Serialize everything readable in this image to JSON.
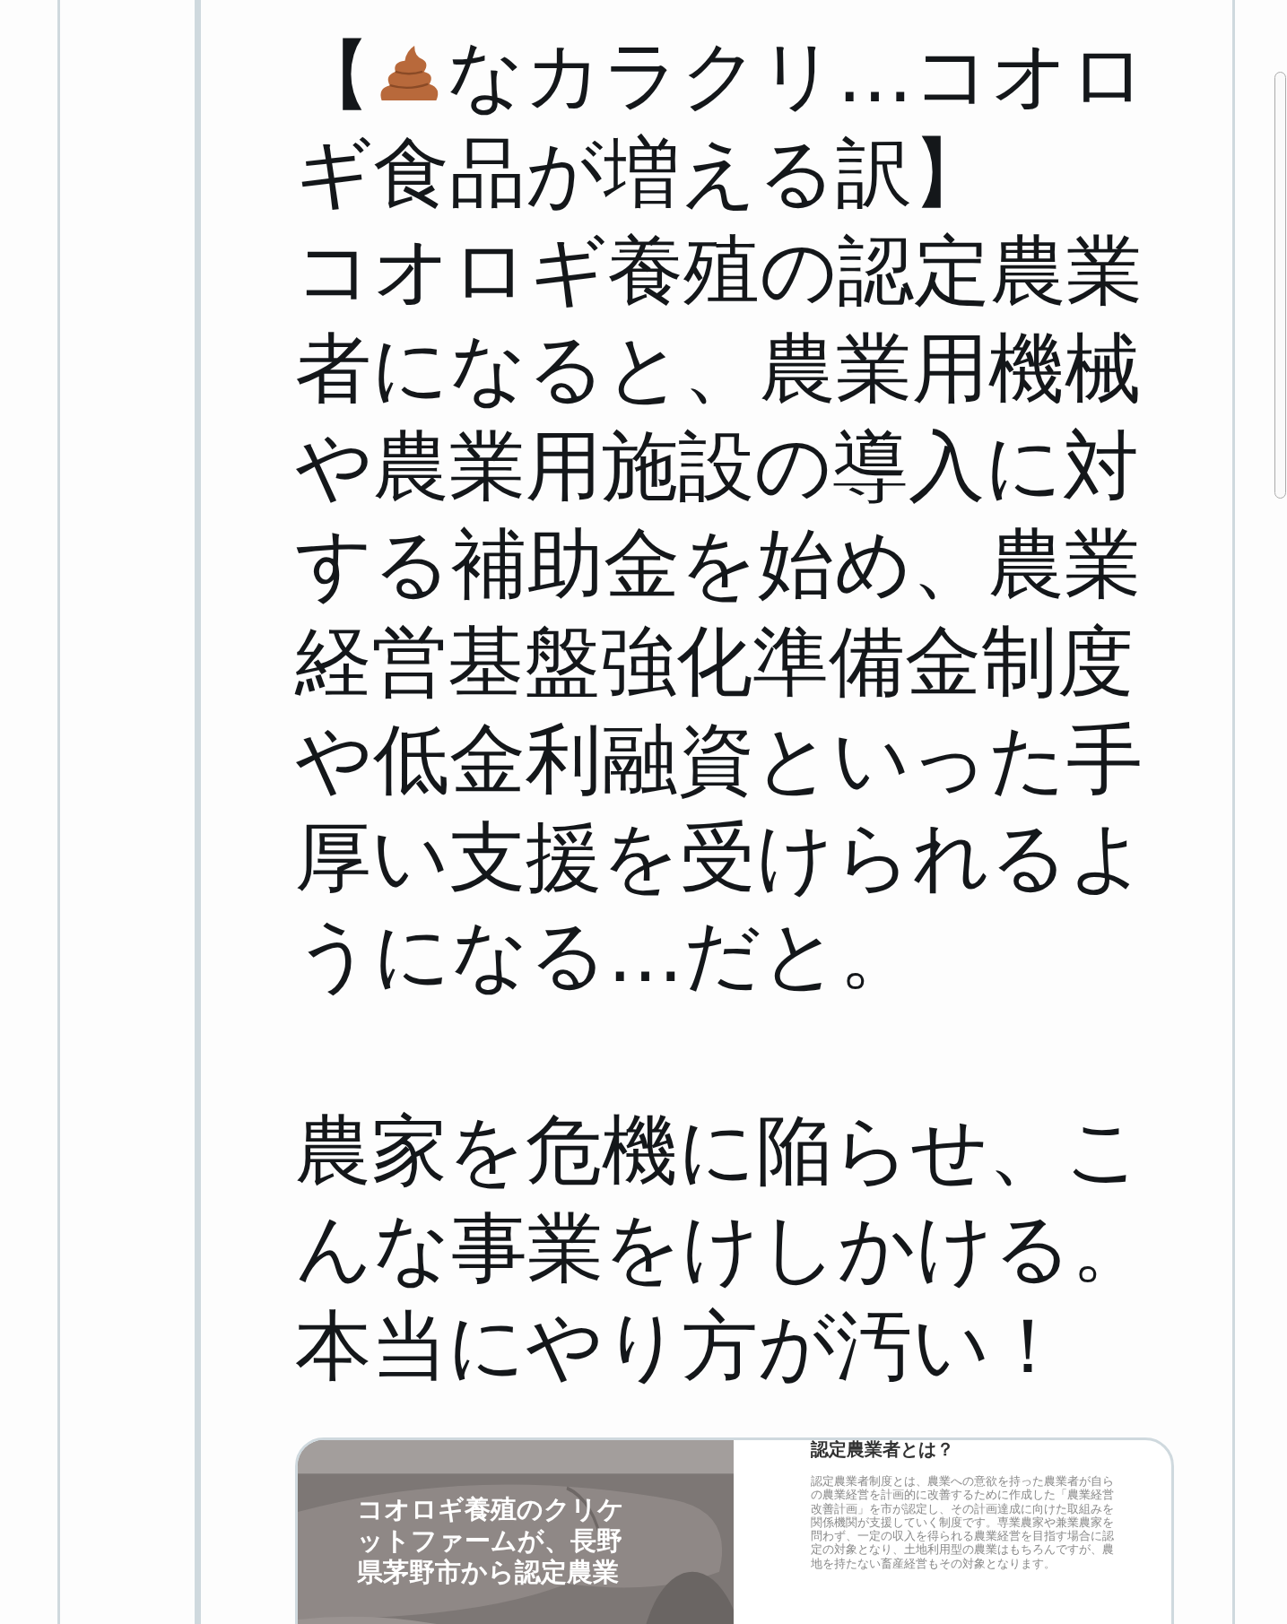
{
  "tweet": {
    "heading": [
      "【",
      "なカラクリ…コオロ",
      "ギ食品が増える訳】"
    ],
    "paragraphs": [
      "コオロギ養殖の認定農業者になると、農業用機械や農業用施設の導入に対する補助金を始め、農業経営基盤強化準備金制度や低金利融資といった手厚い支援を受けられるようになる…だと。",
      "農家を危機に陥らせ、こんな事業をけしかける。",
      "本当にやり方が汚い！"
    ]
  },
  "attachment": {
    "image": {
      "kind": "picture",
      "caption": "コオロギ養殖のクリケットファームが、長野県茅野市から認定農業"
    },
    "document": {
      "title": "認定農業者とは？",
      "text": "認定農業者制度とは、農業への意欲を持った農業者が自らの農業経営を計画的に改善するために作成した「農業経営改善計画」を市が認定し、その計画達成に向けた取組みを関係機関が支援していく制度です。専業農家や兼業農家を問わず、一定の収入を得られる農業経営を目指す場合に認定の対象となり、土地利用型の農業はもちろんですが、農地を持たない畜産経営もその対象となります。"
    }
  }
}
